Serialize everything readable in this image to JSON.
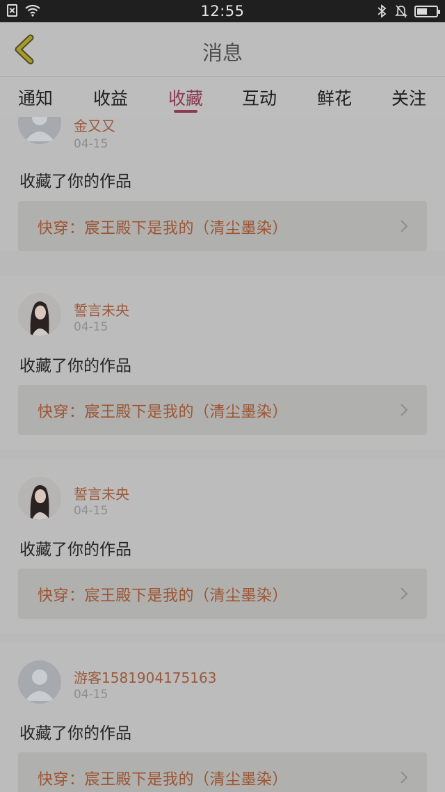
{
  "status": {
    "time": "12:55",
    "battery_level": 0.55,
    "icons": [
      "sim-off-icon",
      "wifi-icon",
      "bluetooth-icon",
      "bell-off-icon",
      "battery-icon"
    ]
  },
  "header": {
    "title": "消息",
    "back_icon": "chevron-left-icon"
  },
  "tabs": [
    {
      "label": "通知",
      "active": false
    },
    {
      "label": "收益",
      "active": false
    },
    {
      "label": "收藏",
      "active": true
    },
    {
      "label": "互动",
      "active": false
    },
    {
      "label": "鲜花",
      "active": false
    },
    {
      "label": "关注",
      "active": false
    }
  ],
  "colors": {
    "accent": "#8a3a52",
    "name": "#9a5a3c",
    "link": "#9d5432"
  },
  "messages": [
    {
      "user": "金又又",
      "date": "04-15",
      "text": "收藏了你的作品",
      "work": "快穿：宸王殿下是我的（清尘墨染）",
      "avatar": "default-avatar"
    },
    {
      "user": "誓言未央",
      "date": "04-15",
      "text": "收藏了你的作品",
      "work": "快穿：宸王殿下是我的（清尘墨染）",
      "avatar": "photo-avatar"
    },
    {
      "user": "誓言未央",
      "date": "04-15",
      "text": "收藏了你的作品",
      "work": "快穿：宸王殿下是我的（清尘墨染）",
      "avatar": "photo-avatar"
    },
    {
      "user": "游客1581904175163",
      "date": "04-15",
      "text": "收藏了你的作品",
      "work": "快穿：宸王殿下是我的（清尘墨染）",
      "avatar": "default-avatar"
    }
  ]
}
